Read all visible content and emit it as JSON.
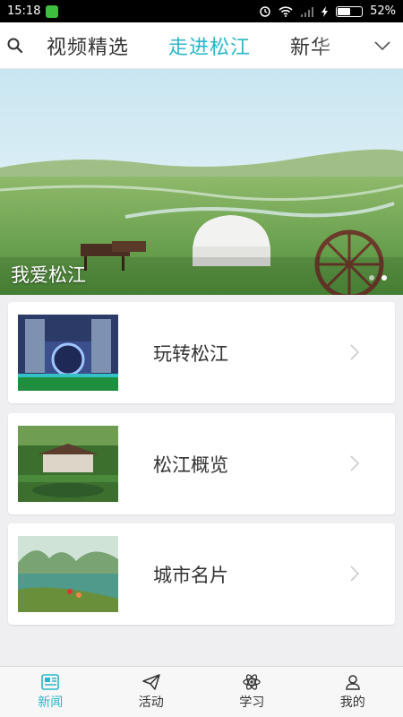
{
  "statusbar": {
    "time": "15:18",
    "battery": "52%",
    "battery_level": 0.52
  },
  "header": {
    "tabs": [
      {
        "label": "视频精选",
        "active": false
      },
      {
        "label": "走进松江",
        "active": true
      },
      {
        "label": "新华",
        "active": false
      }
    ],
    "accent_color": "#29b7c9"
  },
  "banner": {
    "caption": "我爱松江",
    "pages": 2,
    "current_page": 2
  },
  "cards": [
    {
      "label": "玩转松江",
      "thumb": "building-photo"
    },
    {
      "label": "松江概览",
      "thumb": "palace-garden-photo"
    },
    {
      "label": "城市名片",
      "thumb": "river-landscape-photo"
    }
  ],
  "bottom_nav": [
    {
      "label": "新闻",
      "icon": "news-icon",
      "active": true
    },
    {
      "label": "活动",
      "icon": "paper-plane-icon",
      "active": false
    },
    {
      "label": "学习",
      "icon": "atom-icon",
      "active": false
    },
    {
      "label": "我的",
      "icon": "user-icon",
      "active": false
    }
  ]
}
